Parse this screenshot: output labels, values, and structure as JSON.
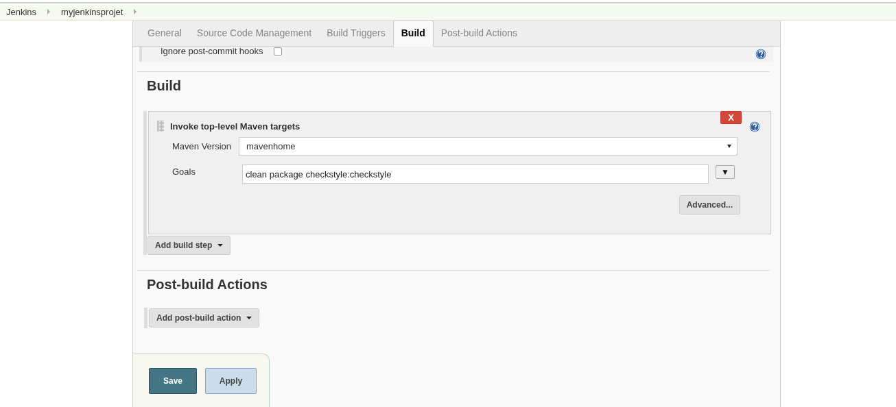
{
  "breadcrumbs": [
    {
      "label": "Jenkins"
    },
    {
      "label": "myjenkinsprojet"
    }
  ],
  "tabs": [
    {
      "label": "General",
      "selected": false
    },
    {
      "label": "Source Code Management",
      "selected": false
    },
    {
      "label": "Build Triggers",
      "selected": false
    },
    {
      "label": "Build",
      "selected": true
    },
    {
      "label": "Post-build Actions",
      "selected": false
    }
  ],
  "previous_option": {
    "label": "Ignore post-commit hooks",
    "checked": false
  },
  "build": {
    "title": "Build",
    "steps": [
      {
        "title": "Invoke top-level Maven targets",
        "delete_label": "X",
        "fields": [
          {
            "kind": "select",
            "label": "Maven Version",
            "value": "mavenhome"
          },
          {
            "kind": "text",
            "label": "Goals",
            "value": "clean package checkstyle:checkstyle",
            "expand_label": "▼"
          }
        ],
        "advanced_button": "Advanced..."
      }
    ],
    "add_button": "Add build step"
  },
  "post_build": {
    "title": "Post-build Actions",
    "add_button": "Add post-build action"
  },
  "buttons": [
    {
      "kind": "primary",
      "label": "Save"
    },
    {
      "kind": "secondary",
      "label": "Apply"
    }
  ]
}
